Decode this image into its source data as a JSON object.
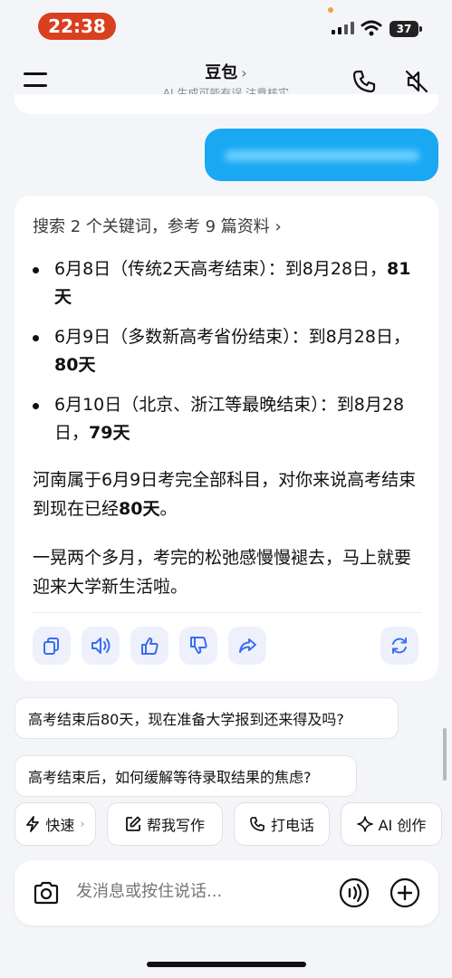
{
  "status_bar": {
    "time": "22:38",
    "battery": "37"
  },
  "header": {
    "title": "豆包",
    "title_chevron": "›",
    "subtitle": "AI 生成可能有误 注意核实"
  },
  "answer": {
    "search_ref": "搜索 2 个关键词，参考 9 篇资料 ›",
    "bullets": [
      {
        "text": "6月8日（传统2天高考结束）：到8月28日，",
        "bold": "81天"
      },
      {
        "text": "6月9日（多数新高考省份结束）：到8月28日，",
        "bold": "80天"
      },
      {
        "text": "6月10日（北京、浙江等最晚结束）：到8月28日，",
        "bold": "79天"
      }
    ],
    "para1_text": "河南属于6月9日考完全部科目，对你来说高考结束到现在已经",
    "para1_bold": "80天",
    "para1_end": "。",
    "para2": "一晃两个多月，考完的松弛感慢慢褪去，马上就要迎来大学新生活啦。"
  },
  "suggestions": [
    "高考结束后80天，现在准备大学报到还来得及吗?",
    "高考结束后，如何缓解等待录取结果的焦虑?"
  ],
  "toolbar": {
    "quick": "快速",
    "quick_arrow": "›",
    "write": "帮我写作",
    "call": "打电话",
    "create": "AI 创作"
  },
  "input": {
    "placeholder": "发消息或按住说话..."
  },
  "colors": {
    "accent": "#1aa8f3",
    "time_pill": "#d8401f",
    "icon_blue": "#3b6df2"
  }
}
